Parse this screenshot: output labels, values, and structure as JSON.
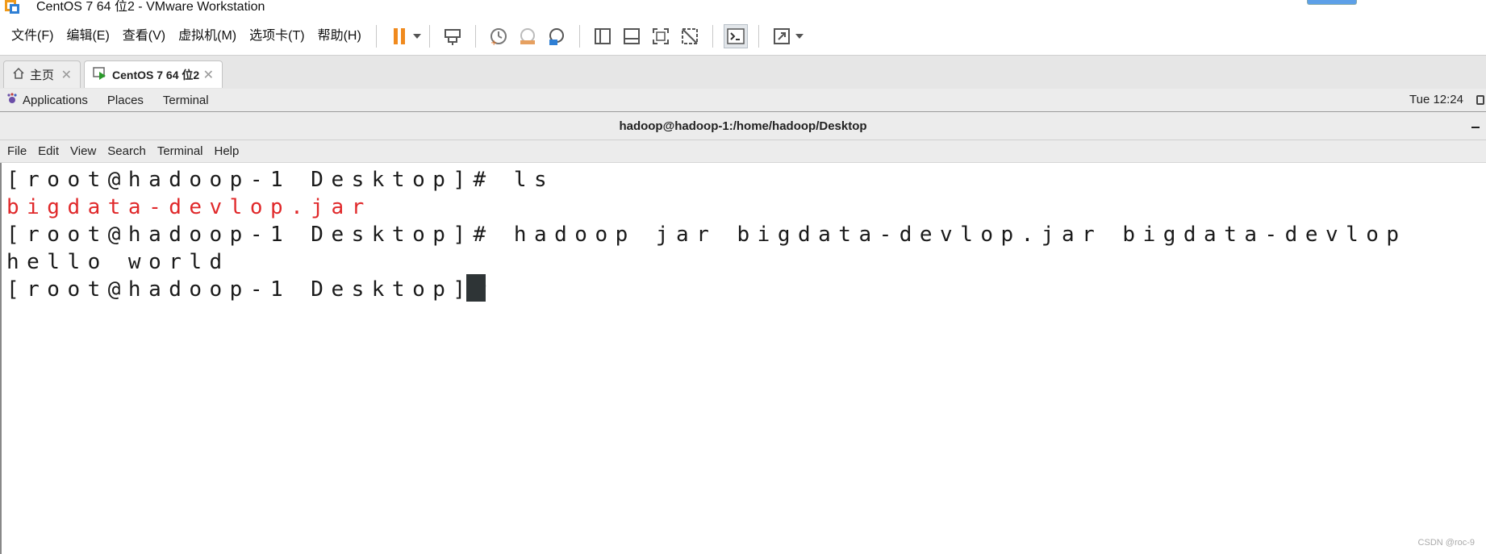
{
  "window": {
    "title": "CentOS 7 64 位2 - VMware Workstation"
  },
  "menu": {
    "items": [
      "文件(F)",
      "编辑(E)",
      "查看(V)",
      "虚拟机(M)",
      "选项卡(T)",
      "帮助(H)"
    ]
  },
  "toolbar": {
    "icons": [
      "pause-icon",
      "send-ctrl-alt-del-icon",
      "snapshot-icon",
      "revert-snapshot-icon",
      "snapshot-manager-icon",
      "show-library-icon",
      "thumbnail-bar-icon",
      "fullscreen-icon",
      "unity-icon",
      "console-view-icon",
      "stretch-icon"
    ],
    "accent": "#f08a1e"
  },
  "tabs": [
    {
      "label": "主页",
      "icon": "home-icon",
      "active": false
    },
    {
      "label": "CentOS 7 64 位2",
      "icon": "vm-icon",
      "active": true
    }
  ],
  "gnome_panel": {
    "applications": "Applications",
    "places": "Places",
    "terminal": "Terminal",
    "clock": "Tue 12:24"
  },
  "terminal": {
    "title": "hadoop@hadoop-1:/home/hadoop/Desktop",
    "menu": [
      "File",
      "Edit",
      "View",
      "Search",
      "Terminal",
      "Help"
    ],
    "lines": [
      "[root@hadoop-1 Desktop]# ls",
      "bigdata-devlop.jar",
      "[root@hadoop-1 Desktop]# hadoop jar bigdata-devlop.jar bigdata-devlop",
      "hello world",
      "[root@hadoop-1 Desktop]# "
    ],
    "highlight_color": "#e0282a"
  },
  "watermark": "CSDN @roc-9"
}
